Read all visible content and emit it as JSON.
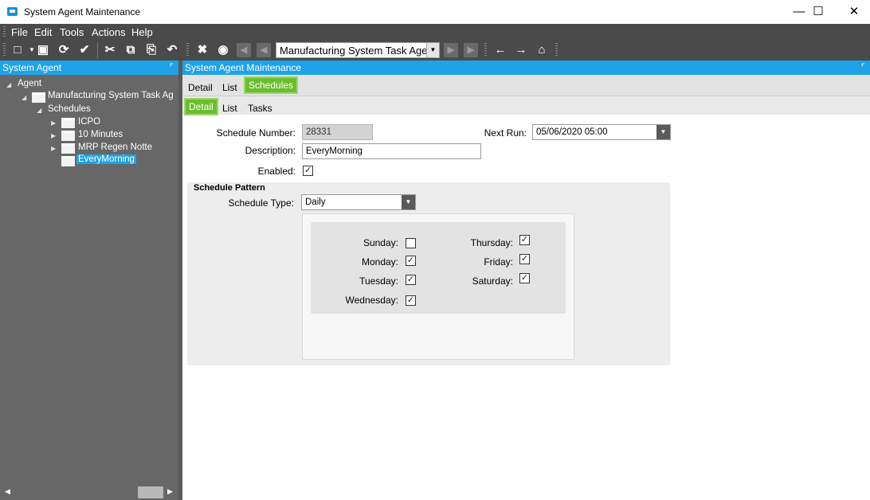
{
  "window": {
    "title": "System Agent Maintenance",
    "controls": {
      "minimize": "—",
      "maximize": "☐",
      "close": "✕"
    }
  },
  "menu": [
    "File",
    "Edit",
    "Tools",
    "Actions",
    "Help"
  ],
  "toolbar": {
    "navigator_value": "Manufacturing System Task Agent",
    "icons": [
      "new-icon",
      "save-icon",
      "refresh-icon",
      "clear-icon",
      "cut-icon",
      "copy-icon",
      "paste-icon",
      "undo-icon",
      "delete-icon",
      "search-icon",
      "first-record-icon",
      "previous-record-icon",
      "next-record-icon",
      "last-record-icon",
      "back-icon",
      "forward-icon",
      "home-icon"
    ]
  },
  "tree": {
    "header": "System Agent",
    "root": "Agent",
    "agent": "Manufacturing System Task Ag",
    "schedules": "Schedules",
    "items": [
      "ICPO",
      "10 Minutes",
      "MRP Regen Notte",
      "EveryMorning"
    ],
    "selected": "EveryMorning"
  },
  "main": {
    "header": "System Agent Maintenance",
    "tabs": [
      "Detail",
      "List",
      "Schedules"
    ],
    "active_tab": "Schedules",
    "subtabs": [
      "Detail",
      "List",
      "Tasks"
    ],
    "active_subtab": "Detail"
  },
  "form": {
    "schedule_number_label": "Schedule Number:",
    "schedule_number": "28331",
    "description_label": "Description:",
    "description": "EveryMorning",
    "enabled_label": "Enabled:",
    "enabled": true,
    "next_run_label": "Next Run:",
    "next_run": "05/06/2020 05:00",
    "pattern_title": "Schedule Pattern",
    "schedule_type_label": "Schedule Type:",
    "schedule_type": "Daily",
    "days": [
      {
        "label": "Sunday:",
        "checked": false
      },
      {
        "label": "Monday:",
        "checked": true
      },
      {
        "label": "Tuesday:",
        "checked": true
      },
      {
        "label": "Wednesday:",
        "checked": true
      },
      {
        "label": "Thursday:",
        "checked": true
      },
      {
        "label": "Friday:",
        "checked": true
      },
      {
        "label": "Saturday:",
        "checked": true
      }
    ]
  },
  "colors": {
    "accent": "#1ea3e8",
    "active_tab": "#6bbd2f",
    "chrome": "#4a4a4a",
    "tree_bg": "#676767"
  }
}
